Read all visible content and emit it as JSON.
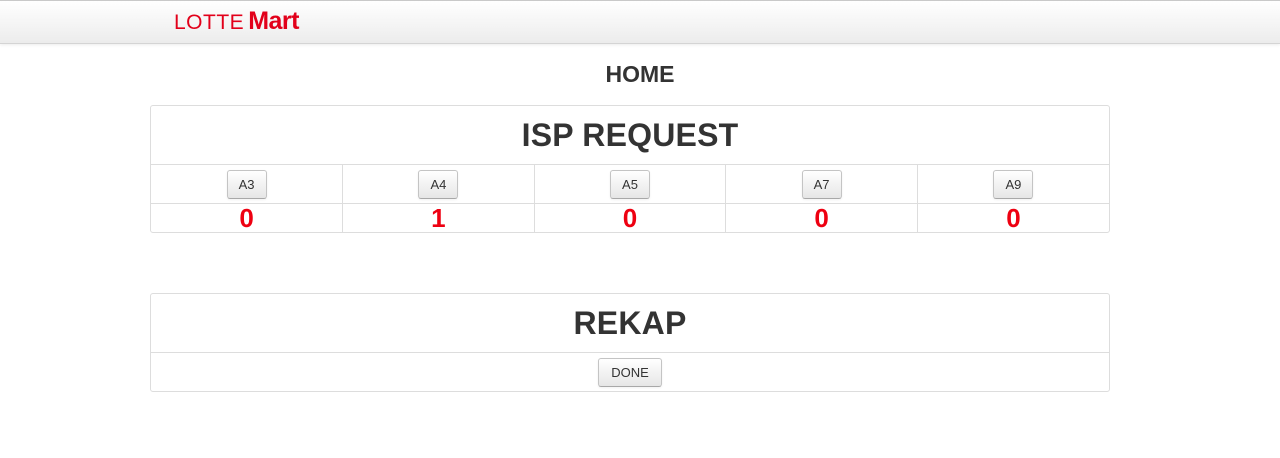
{
  "brand": {
    "lotte": "LOTTE",
    "mart": "Mart",
    "color": "#e2001a"
  },
  "page_title": "HOME",
  "isp_request": {
    "title": "ISP REQUEST",
    "value_color": "#ee0011",
    "columns": [
      {
        "button": "A3",
        "count": "0"
      },
      {
        "button": "A4",
        "count": "1"
      },
      {
        "button": "A5",
        "count": "0"
      },
      {
        "button": "A7",
        "count": "0"
      },
      {
        "button": "A9",
        "count": "0"
      }
    ]
  },
  "rekap": {
    "title": "REKAP",
    "done_label": "DONE"
  }
}
